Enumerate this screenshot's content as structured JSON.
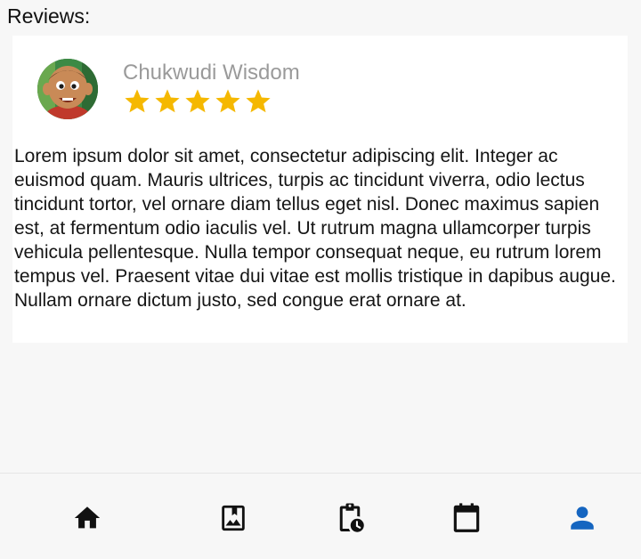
{
  "section": {
    "title": "Reviews:"
  },
  "review": {
    "reviewer_name": "Chukwudi Wisdom",
    "rating": 5,
    "rating_max": 5,
    "text": "Lorem ipsum dolor sit amet, consectetur adipiscing elit. Integer ac euismod quam. Mauris ultrices, turpis ac tincidunt viverra, odio lectus tincidunt tortor, vel ornare diam tellus eget nisl. Donec maximus sapien est, at fermentum odio iaculis vel. Ut rutrum magna ullamcorper turpis vehicula pellentesque. Nulla tempor consequat neque, eu rutrum lorem tempus vel. Praesent vitae dui vitae est mollis tristique in dapibus augue. Nullam ornare dictum justo, sed congue erat ornare at.",
    "avatar_icon": "user-avatar-photo"
  },
  "colors": {
    "star": "#f5b800",
    "nav_icon": "#111111",
    "nav_active": "#1565c0",
    "card_bg": "#ffffff",
    "page_bg": "#f7f7f7"
  },
  "bottom_nav": {
    "items": [
      {
        "icon": "home-icon",
        "active": false
      },
      {
        "icon": "photo-album-icon",
        "active": false
      },
      {
        "icon": "clipboard-clock-icon",
        "active": false
      },
      {
        "icon": "calendar-icon",
        "active": false
      },
      {
        "icon": "person-icon",
        "active": true
      }
    ]
  }
}
